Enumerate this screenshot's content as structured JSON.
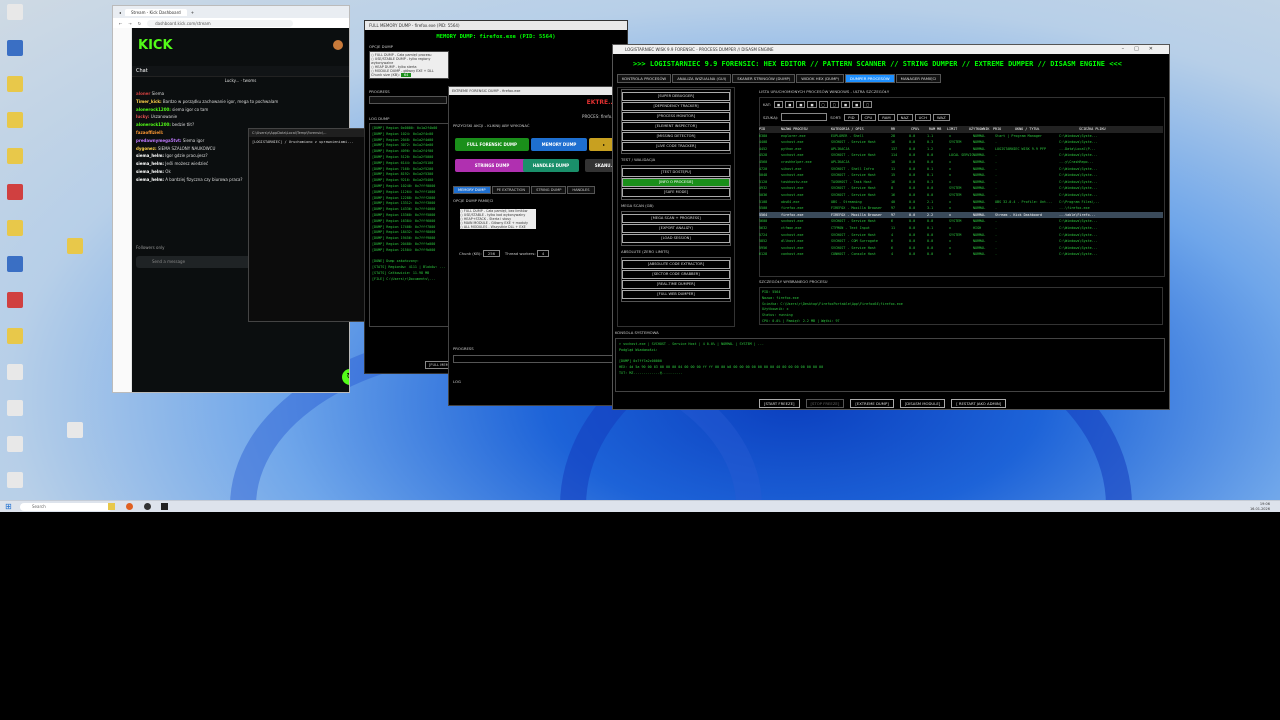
{
  "desktop": {
    "icons": [
      "",
      "",
      "",
      "",
      "",
      "",
      "",
      "",
      "",
      "",
      "",
      "",
      "",
      ""
    ],
    "icon_colors": [
      "#e8e8e8",
      "#3a6fc4",
      "#e8c84a",
      "#e8c84a",
      "#e8c84a",
      "#d04040",
      "#e8c84a",
      "#3a6fc4",
      "#d04040",
      "#e8c84a",
      "#e8e8e8",
      "#e8e8e8",
      "#e8e8e8",
      "#e8e8e8"
    ]
  },
  "browser": {
    "tab_title": "Stream - Kick Dashboard",
    "url": "dashboard.kick.com/stream",
    "chat_label": "Chat",
    "pinned": "Lucky... · twoms",
    "messages": [
      {
        "user": "aloner",
        "text": "Siema"
      },
      {
        "user": "Timer_kick:",
        "text": "Bardzo w porządku zachowanie igor, mega to pochwalam"
      },
      {
        "user": "alonerock1200:",
        "text": "siema igor co tam"
      },
      {
        "user": "lucky:",
        "text": "Uszanowanie"
      },
      {
        "user": "alonerock1200:",
        "text": "bedzie tlit?"
      },
      {
        "user": "",
        "text": ""
      },
      {
        "user": "fazaoffiziell:",
        "text": ""
      },
      {
        "user": "",
        "text": ""
      },
      {
        "user": "predawnymega5tvt:",
        "text": "Siema igor"
      },
      {
        "user": "dygonez:",
        "text": "SIEMA SZALONY NAUKOWCU"
      },
      {
        "user": "siema_helm:",
        "text": "Igor gdzie pracujesz?"
      },
      {
        "user": "siema_helm:",
        "text": "Jeśli możesz wiedzieć"
      },
      {
        "user": "siema_helm:",
        "text": "Ok"
      },
      {
        "user": "siema_helm:",
        "text": "A bardziej fizyczna czy biurowa praca?"
      }
    ],
    "followers_only": "Followers only",
    "send_placeholder": "Send a message"
  },
  "cmd": {
    "path": "C:\\Users\\r\\AppData\\Local\\Temp\\Forensic\\...",
    "lines": [
      "[LOGISTARNIEC] / Uruchomiono z uprawnieniami..."
    ]
  },
  "memdump": {
    "window_title": "FULL MEMORY DUMP - firefox.exe (PID: 5564)",
    "header": "MEMORY DUMP: firefox.exe (PID: 5564)",
    "options_label": "OPCJE DUMP",
    "options": [
      "FULL DUMP - Cała pamięć procesu",
      "USE/STABLE DUMP - tylko regiony wykonywalne",
      "HEAP DUMP - tylko sterta",
      "MODULE DUMP - główny EXE + DLL"
    ],
    "chunk_label": "Chunk size (KB):",
    "chunk_value": "64",
    "progress_label": "PROGRESS",
    "log_label": "LOG DUMP",
    "log_lines": [
      "[DUMP] Region 0x0000: 0x1a2f4b00",
      "[DUMP] Region 1024: 0x1a2f4c00",
      "[DUMP] Region 2048: 0x1a2f4d00",
      "[DUMP] Region 3072: 0x1a2f4e00",
      "[DUMP] Region 4096: 0x1a2f4f00",
      "[DUMP] Region 5120: 0x1a2f5000",
      "[DUMP] Region 6144: 0x1a2f5100",
      "[DUMP] Region 7168: 0x1a2f5200",
      "[DUMP] Region 8192: 0x1a2f5300",
      "[DUMP] Region 9216: 0x1a2f5400",
      "[DUMP] Region 10240: 0x7fff0000",
      "[DUMP] Region 11264: 0x7fff1000",
      "[DUMP] Region 12288: 0x7fff2000",
      "[DUMP] Region 13312: 0x7fff3000",
      "[DUMP] Region 14336: 0x7fff4000",
      "[DUMP] Region 15360: 0x7fff5000",
      "[DUMP] Region 16384: 0x7fff6000",
      "[DUMP] Region 17408: 0x7fff7000",
      "[DUMP] Region 18432: 0x7fff8000",
      "[DUMP] Region 19456: 0x7fff9000",
      "[DUMP] Region 20480: 0x7fffa000",
      "[DUMP] Region 21504: 0x7fffb000",
      "",
      "[DONE] Dump zakończony:",
      "[STATS] Regionów: 4111 | Bloków: ...",
      "[STATS] Całkowicie: 11.98 MB",
      "[FILE] C:\\Users\\r\\Documents\\..."
    ],
    "full_button": "[FULL MEMORY DUMP]"
  },
  "forensic": {
    "window_title": "EKTREME FORENSIC DUMP - firefox.exe",
    "warning": "EKTRE...",
    "process_label": "PROCES: firefo...",
    "section": "PRZYCISKI AKCJI - KLIKNIJ ABY WYKONAĆ",
    "buttons": [
      "FULL FORENSIC DUMP",
      "MEMORY DUMP",
      "STRINGS DUMP",
      "HANDLES DUMP",
      "SKANU..."
    ],
    "tabs": [
      "MEMORY DUMP",
      "PE EXTRACTION",
      "STRING DUMP",
      "HANDLES"
    ],
    "options_label": "OPCJE DUMP PAMIĘCI",
    "options": [
      "FULL DUMP - Cała pamięć, bez limitów",
      "USE/STABLE - tylko kod wykonywalny",
      "HEAP+STACK - Sterta i stosy",
      "MAIN MODULE - Główny EXE + moduły",
      "ALL MODULES - Wszystkie DLL + EXE"
    ],
    "chunk_label": "Chunk (KB):",
    "chunk_value": "256",
    "threads_label": "Thread workers:",
    "threads_value": "4",
    "progress_label": "PROGRESS",
    "log_label": "LOG"
  },
  "main": {
    "window_title": "LOGISTARNIEC WISK 9.9 FORENSIC - PROCESS DUMPER // DISASM ENGINE",
    "app_title": ">>> LOGISTARNIEC 9.9 FORENSIC: HEX EDITOR // PATTERN SCANNER // STRING DUMPER // EXTREME DUMPER // DISASM ENGINE <<<",
    "tabs": [
      "KONTROLA PROCESÓW",
      "ANALIZA WIZUALNA (GUI)",
      "SKANER STRINGÓW (DUMP)",
      "WIDOK HEX (DUMP)",
      "DUMPER PROCESÓW",
      "MANAGER PAMIĘCI"
    ],
    "active_tab": 4,
    "left": {
      "buttons_top": [
        "[SUPER DEBUGGER]",
        "[DEPENDENCY TRACKER]",
        "[PROCESS MONITOR]",
        "[ELEMENT INSPECTOR]",
        "[MISSING DETECTOR]",
        "[LIVE CODE TRACKER]"
      ],
      "test_label": "TEST / WALIDACJA",
      "buttons_test": [
        "[TEST DOSTĘPU]",
        "[INFO O PROCESIE]",
        "[SAFE MODE]"
      ],
      "mega_label": "MEGA SCAN (GB)",
      "buttons_mega": [
        "[MEGA SCAN + PROGRESS]",
        "[EXPORT ANALIZY]",
        "[LOAD SESSION]"
      ],
      "absolute_label": "ABSOLUTE (ZERO LIMITS)",
      "buttons_abs": [
        "[ABSOLUTE CODE EXTRACTOR]",
        "[SECTOR CODE GRABBER]",
        "[REAL-TIME DUMPER]",
        "[FULL WEB DUMPER]"
      ]
    },
    "list_title": "LISTA URUCHOMIONYCH PROCESÓW WINDOWS - ULTRA SZCZEGÓŁY",
    "filter_label": "KAT:",
    "search_label": "SZUKAJ:",
    "sort_label": "SORT:",
    "sort_buttons": [
      "PID",
      "CPU",
      "RAM",
      "NAZ",
      "UCH",
      "WAZ"
    ],
    "headers": [
      "PID",
      "NAZWA PROCESU",
      "KATEGORIA / OPIS",
      "RR",
      "CPU%",
      "RAM MB",
      "LIMIT",
      "UŻYTKOWNIK",
      "PRIO",
      "OKNO / TYTUŁ",
      "ŚCIEŻKA PLIKU"
    ],
    "rows": [
      [
        "6380",
        "explorer.exe",
        "EXPLORER - Shell",
        "28",
        "0.0",
        "1.1",
        "x",
        "NORMAL",
        "Start | Program Manager",
        "C:\\Windows\\Syste..."
      ],
      [
        "4408",
        "svchost.exe",
        "SVCHOST - Service Host",
        "16",
        "0.0",
        "0.3",
        "SYSTEM",
        "NORMAL",
        "-",
        "C:\\Windows\\Syste..."
      ],
      [
        "4452",
        "python.exe",
        "APLIKACJA",
        "137",
        "0.0",
        "1.2",
        "x",
        "NORMAL",
        "LOGISTARNIEC WISK 9.9 PFP",
        "...Data\\Local\\P..."
      ],
      [
        "4528",
        "svchost.exe",
        "SVCHOST - Service Host",
        "114",
        "0.0",
        "0.0",
        "LOCAL SERVICE",
        "NORMAL",
        "-",
        "C:\\Windows\\Syste..."
      ],
      [
        "4560",
        "crashhelper.exe",
        "APLIKACJA",
        "10",
        "0.0",
        "0.0",
        "x",
        "NORMAL",
        "-",
        "...y\\CrashRepo..."
      ],
      [
        "4720",
        "sihost.exe",
        "SVCHOST - Shell Infra",
        "11",
        "0.0",
        "0.1",
        "x",
        "NORMAL",
        "-",
        "C:\\Windows\\Syste..."
      ],
      [
        "5048",
        "svchost.exe",
        "SVCHOST - Service Host",
        "15",
        "0.0",
        "0.1",
        "x",
        "NORMAL",
        "-",
        "C:\\Windows\\Syste..."
      ],
      [
        "5120",
        "taskhostw.exe",
        "TASKHOST - Task Host",
        "16",
        "0.0",
        "0.3",
        "x",
        "NORMAL",
        "-",
        "C:\\Windows\\Syste..."
      ],
      [
        "4932",
        "svchost.exe",
        "SVCHOST - Service Host",
        "8",
        "0.0",
        "0.0",
        "SYSTEM",
        "NORMAL",
        "-",
        "C:\\Windows\\Syste..."
      ],
      [
        "5036",
        "svchost.exe",
        "SVCHOST - Service Host",
        "16",
        "0.0",
        "0.0",
        "SYSTEM",
        "NORMAL",
        "-",
        "C:\\Windows\\Syste..."
      ],
      [
        "5108",
        "obs64.exe",
        "OBS - Streaming",
        "40",
        "0.0",
        "2.1",
        "x",
        "NORMAL",
        "OBS 32.0.4 - Profile: Unt...",
        "C:\\Program Files\\..."
      ],
      [
        "5500",
        "firefox.exe",
        "FIREFOX - Mozilla Browser",
        "97",
        "0.0",
        "3.1",
        "x",
        "NORMAL",
        "-",
        "...\\firefox.exe"
      ],
      [
        "5564",
        "firefox.exe",
        "FIREFOX - Mozilla Browser",
        "97",
        "0.0",
        "2.2",
        "x",
        "NORMAL",
        "Stream - Kick Dashboard",
        "...table\\Firefo..."
      ],
      [
        "5600",
        "svchost.exe",
        "SVCHOST - Service Host",
        "6",
        "0.0",
        "0.0",
        "SYSTEM",
        "NORMAL",
        "-",
        "C:\\Windows\\Syste..."
      ],
      [
        "5632",
        "ctfmon.exe",
        "CTFMON - Text Input",
        "11",
        "0.0",
        "0.1",
        "x",
        "HIGH",
        "-",
        "C:\\Windows\\Syste..."
      ],
      [
        "5724",
        "svchost.exe",
        "SVCHOST - Service Host",
        "4",
        "0.0",
        "0.0",
        "SYSTEM",
        "NORMAL",
        "-",
        "C:\\Windows\\Syste..."
      ],
      [
        "5852",
        "dllhost.exe",
        "SVCHOST - COM Surrogate",
        "6",
        "0.0",
        "0.0",
        "x",
        "NORMAL",
        "-",
        "C:\\Windows\\Syste..."
      ],
      [
        "5956",
        "svchost.exe",
        "SVCHOST - Service Host",
        "6",
        "0.0",
        "0.0",
        "x",
        "NORMAL",
        "-",
        "C:\\Windows\\Syste..."
      ],
      [
        "6128",
        "conhost.exe",
        "CONHOST - Console Host",
        "4",
        "0.0",
        "0.0",
        "x",
        "NORMAL",
        "-",
        "C:\\Windows\\Syste..."
      ]
    ],
    "selected_row": 12,
    "details_title": "SZCZEGÓŁY WYBRANEGO PROCESU",
    "details": [
      "PID: 5564",
      "Nazwa: firefox.exe",
      "Ścieżka: C:\\Users\\r\\Desktop\\FirefoxPortable\\App\\Firefox64\\firefox.exe",
      "Użytkownik: x",
      "Status: running",
      "CPU: 0.0% | Pamięć: 2.2 MB | Wątki: 97"
    ],
    "console_title": "KONSOLA SYSTEMOWA",
    "console_lines": [
      "> svchost.exe | SVCHOST - Service Host | 4 0.0% | NORMAL | SYSTEM | ...",
      "Podgląd Wiadomości:",
      "",
      "[DUMP] 0x7ff7a2c00000",
      "HEX: 4d 5a 90 00 03 00 00 00 04 00 00 00 ff ff 00 00 b8 00 00 00 00 00 00 00 40 00 00 00 00 00 00 00",
      "TXT: MZ.............@.........."
    ],
    "bottom_buttons": [
      "[START FREEZE]",
      "[STOP FREEZE]",
      "[EXTREME DUMP]",
      "[DISASM MODULE]",
      "[ RESTART JAKO ADMIN]"
    ]
  },
  "taskbar": {
    "search_placeholder": "Search",
    "time": "19:06",
    "date": "16.01.2026"
  }
}
